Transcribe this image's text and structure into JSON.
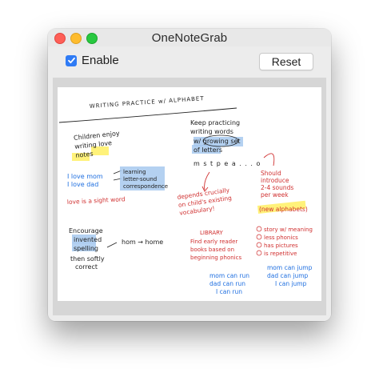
{
  "window": {
    "title": "OneNoteGrab"
  },
  "toolbar": {
    "enable_label": "Enable",
    "enable_checked": true,
    "reset_label": "Reset"
  },
  "note": {
    "heading": "WRITING PRACTICE w/ ALPHABET",
    "block1": [
      "Children enjoy",
      "writing love",
      "notes"
    ],
    "block1b": [
      "I love mom",
      "I love dad"
    ],
    "block1c": [
      "learning",
      "letter-sound",
      "correspondence"
    ],
    "red1": "love is a sight word",
    "block2": [
      "Keep practicing",
      "writing words",
      "w/ growing set",
      "of letters"
    ],
    "letters": "m s t p e a . . . o",
    "red2": [
      "depends crucially",
      "on child's existing",
      "vocabulary!"
    ],
    "red3": [
      "Should",
      "introduce",
      "2-4 sounds",
      "per week",
      "(new alphabets)"
    ],
    "block3": [
      "Encourage",
      "invented",
      "spelling",
      "then softly",
      "correct"
    ],
    "arrow_note": "hom → home",
    "red4": [
      "LIBRARY",
      "Find early reader",
      "books based on",
      "beginning phonics"
    ],
    "red5": [
      "story w/ meaning",
      "less phonics",
      "has pictures",
      "is repetitive"
    ],
    "blue1": [
      "mom can run",
      "dad can run",
      "I can run"
    ],
    "blue2": [
      "mom can jump",
      "dad can jump",
      "I can jump"
    ]
  }
}
